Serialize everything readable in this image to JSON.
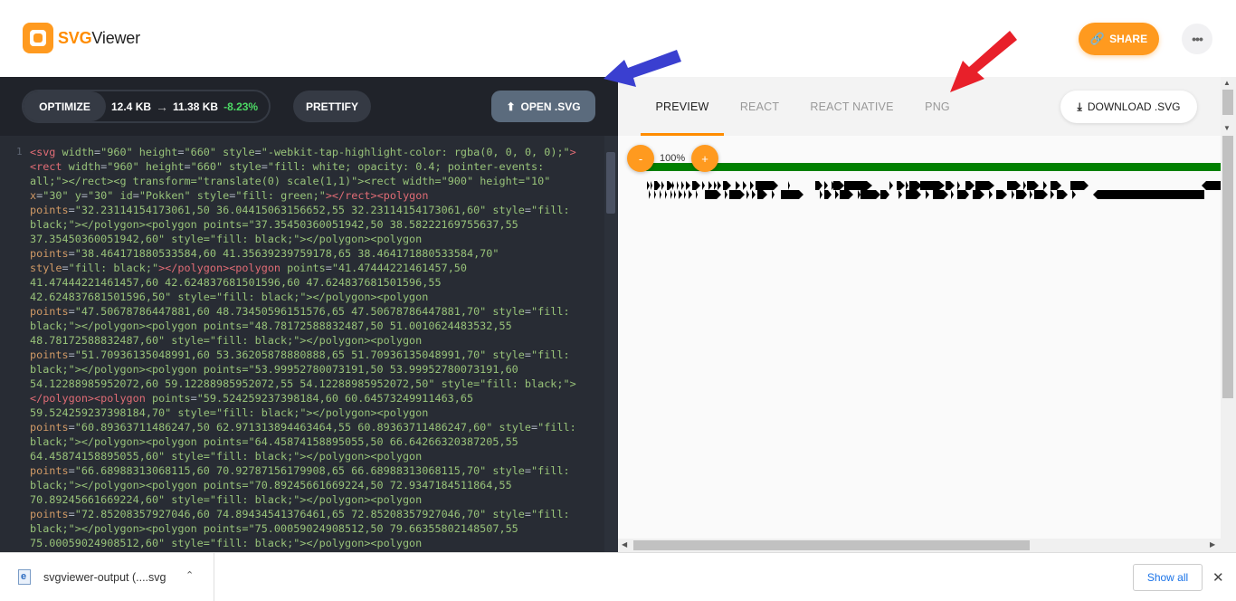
{
  "header": {
    "logo_prefix": "SVG",
    "logo_suffix": "Viewer",
    "share_label": "SHARE",
    "more_label": "•••",
    "accent": "#ff9a1f"
  },
  "editor": {
    "optimize_label": "OPTIMIZE",
    "size_before": "12.4 KB",
    "size_after": "11.38 KB",
    "size_change": "-8.23%",
    "prettify_label": "PRETTIFY",
    "open_label": "OPEN .SVG",
    "line_number": "1",
    "code_lines": [
      "<svg width=\"960\" height=\"660\" style=\"-webkit-tap-highlight-color: rgba(0, 0, 0, 0);\">",
      "<rect width=\"960\" height=\"660\" style=\"fill: white; opacity: 0.4; pointer-events:",
      "all;\"></rect><g transform=\"translate(0) scale(1,1)\"><rect width=\"900\" height=\"10\"",
      "x=\"30\" y=\"30\" id=\"Pokken\" style=\"fill: green;\"></rect><polygon",
      "points=\"32.23114154173061,50 36.04415063156652,55 32.23114154173061,60\" style=\"fill:",
      "black;\"></polygon><polygon points=\"37.35450360051942,50 38.58222169755637,55",
      "37.35450360051942,60\" style=\"fill: black;\"></polygon><polygon",
      "points=\"38.464171880533584,60 41.35639239759178,65 38.464171880533584,70\"",
      "style=\"fill: black;\"></polygon><polygon points=\"41.47444221461457,50",
      "41.47444221461457,60 42.624837681501596,60 47.624837681501596,55",
      "42.624837681501596,50\" style=\"fill: black;\"></polygon><polygon",
      "points=\"47.50678786447881,60 48.73450596151576,65 47.50678786447881,70\" style=\"fill:",
      "black;\"></polygon><polygon points=\"48.78172588832487,50 51.0010624483532,55",
      "48.78172588832487,60\" style=\"fill: black;\"></polygon><polygon",
      "points=\"51.70936135048991,60 53.36205878880888,65 51.70936135048991,70\" style=\"fill:",
      "black;\"></polygon><polygon points=\"53.99952780073191,50 53.99952780073191,60",
      "54.12288985952072,60 59.12288985952072,55 54.12288985952072,50\" style=\"fill: black;\">",
      "</polygon><polygon points=\"59.524259237398184,60 60.64573249911463,65",
      "59.524259237398184,70\" style=\"fill: black;\"></polygon><polygon",
      "points=\"60.89363711486247,50 62.971313894463464,55 60.89363711486247,60\" style=\"fill:",
      "black;\"></polygon><polygon points=\"64.45874158895055,50 66.64266320387205,55",
      "64.45874158895055,60\" style=\"fill: black;\"></polygon><polygon",
      "points=\"66.68988313068115,60 70.92787156179908,65 66.68988313068115,70\" style=\"fill:",
      "black;\"></polygon><polygon points=\"70.89245661669224,50 72.9347184511864,55",
      "70.89245661669224,60\" style=\"fill: black;\"></polygon><polygon",
      "points=\"72.85208357927046,60 74.89434541376461,65 72.85208357927046,70\" style=\"fill:",
      "black;\"></polygon><polygon points=\"75.00059024908512,50 79.66355802148507,55",
      "75.00059024908512,60\" style=\"fill: black;\"></polygon><polygon"
    ]
  },
  "preview": {
    "tabs": [
      {
        "label": "PREVIEW",
        "active": true
      },
      {
        "label": "REACT",
        "active": false
      },
      {
        "label": "REACT NATIVE",
        "active": false
      },
      {
        "label": "PNG",
        "active": false
      }
    ],
    "download_label": "DOWNLOAD .SVG",
    "zoom_minus": "-",
    "zoom_plus": "+",
    "zoom_level": "100%",
    "bar_color": "#008000"
  },
  "download_bar": {
    "file_name": "svgviewer-output (....svg",
    "show_all_label": "Show all",
    "close_label": "✕"
  },
  "annotation_colors": {
    "blue_arrow": "#3a3fd0",
    "red_arrow": "#e8202a"
  }
}
